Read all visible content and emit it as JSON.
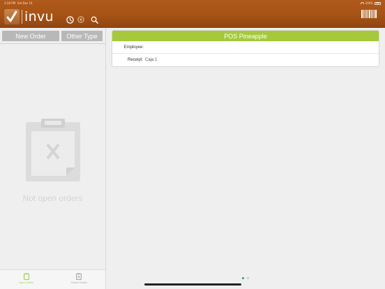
{
  "status_bar": {
    "time": "2:28 PM",
    "date": "Sat Dec 14",
    "battery": "100%"
  },
  "brand": {
    "name": "invu"
  },
  "toolbar": {
    "clock_icon": "clock-icon",
    "add_icon": "plus-circle-icon",
    "search_icon": "search-icon",
    "barcode_icon": "barcode-icon"
  },
  "sidebar": {
    "new_order_label": "New Order",
    "other_type_label": "Other Type",
    "empty_text": "Not open orders",
    "tabs": [
      {
        "label": "Open Orders",
        "icon": "open-orders-icon",
        "active": true
      },
      {
        "label": "Closed Orders",
        "icon": "closed-orders-icon",
        "active": false
      }
    ]
  },
  "pos_card": {
    "title": "POS Pineapple",
    "employee_label": "Employee:",
    "employee_value": "",
    "receipt_label": "Receipt:",
    "receipt_value": "Caja 1"
  },
  "pager": {
    "current": 1,
    "total": 2
  },
  "colors": {
    "brand": "#a65315",
    "accent": "#a5c93a",
    "tab_active": "#9fd24a"
  }
}
